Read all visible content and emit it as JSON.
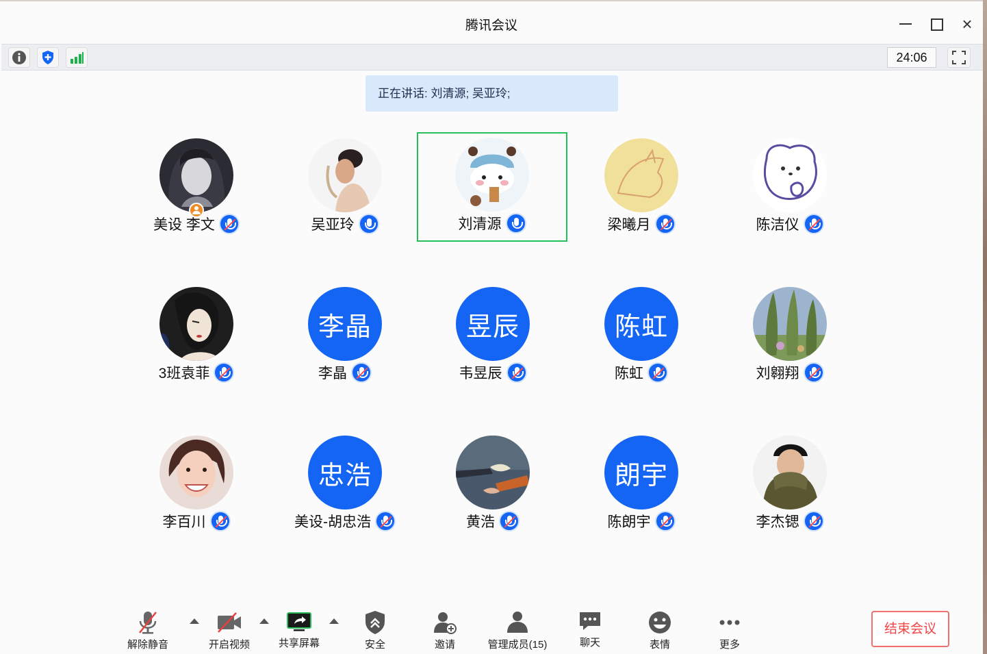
{
  "window": {
    "title": "腾讯会议"
  },
  "infobar": {
    "timer": "24:06"
  },
  "speaking": "正在讲话: 刘清源; 吴亚玲;",
  "participants": [
    {
      "name": "美设 李文",
      "avatar": "photo-dark-anime-girl",
      "host": true,
      "muted": true
    },
    {
      "name": "吴亚玲",
      "avatar": "photo-woman-profile",
      "muted": false
    },
    {
      "name": "刘清源",
      "avatar": "cartoon-bear-hat",
      "muted": false,
      "active_speaker": true
    },
    {
      "name": "梁曦月",
      "avatar": "sketch-cat-yellow",
      "muted": true
    },
    {
      "name": "陈洁仪",
      "avatar": "cartoon-white-bear",
      "muted": true
    },
    {
      "name": "3班袁菲",
      "avatar": "illustration-woman-retro",
      "muted": true
    },
    {
      "name": "李晶",
      "avatar_text": "李晶",
      "muted": true
    },
    {
      "name": "韦昱辰",
      "avatar_text": "昱辰",
      "muted": true
    },
    {
      "name": "陈虹",
      "avatar_text": "陈虹",
      "muted": true
    },
    {
      "name": "刘翱翔",
      "avatar": "painting-trees",
      "muted": true
    },
    {
      "name": "李百川",
      "avatar": "photo-smiling-woman",
      "muted": true
    },
    {
      "name": "美设-胡忠浩",
      "avatar_text": "忠浩",
      "muted": true
    },
    {
      "name": "黄浩",
      "avatar": "photo-hands-flower",
      "muted": true
    },
    {
      "name": "陈朗宇",
      "avatar_text": "朗宇",
      "muted": true
    },
    {
      "name": "李杰锶",
      "avatar": "photo-man-sweater",
      "muted": true
    }
  ],
  "toolbar": {
    "unmute": "解除静音",
    "video": "开启视频",
    "share": "共享屏幕",
    "security": "安全",
    "invite": "邀请",
    "members": "管理成员(15)",
    "chat": "聊天",
    "emoji": "表情",
    "more": "更多",
    "end": "结束会议"
  },
  "colors": {
    "accent": "#1565f5",
    "active_border": "#25c05a",
    "end": "#f04545",
    "signal": "#19b34a"
  }
}
